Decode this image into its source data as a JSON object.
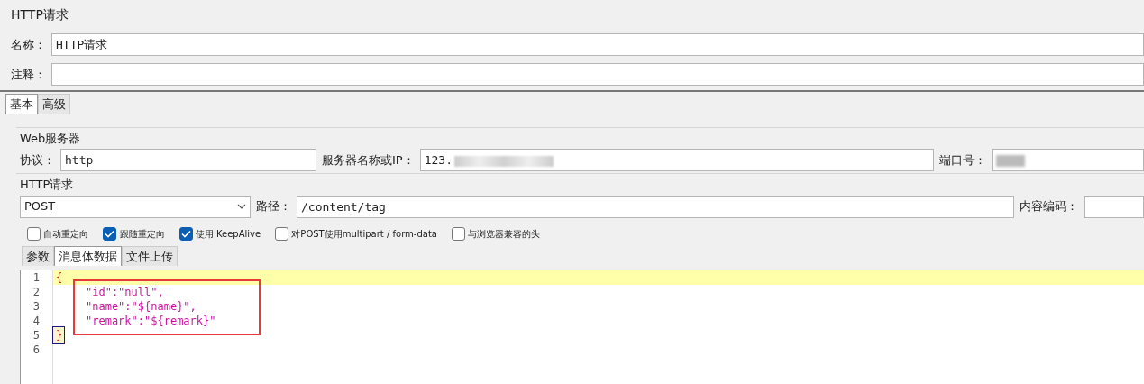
{
  "panel_title": "HTTP请求",
  "name_field": {
    "label": "名称：",
    "value": "HTTP请求"
  },
  "comment_field": {
    "label": "注释："
  },
  "tabs": [
    {
      "label": "基本",
      "selected": true
    },
    {
      "label": "高级",
      "selected": false
    }
  ],
  "web_server": {
    "title": "Web服务器",
    "protocol_label": "协议：",
    "protocol": "http",
    "server_label": "服务器名称或IP：",
    "server": "123.",
    "port_label": "端口号："
  },
  "http_request": {
    "title": "HTTP请求",
    "method": "POST",
    "path_label": "路径：",
    "path": "/content/tag",
    "encoding_label": "内容编码："
  },
  "options": [
    {
      "label": "自动重定向",
      "checked": false
    },
    {
      "label": "跟随重定向",
      "checked": true
    },
    {
      "label": "使用 KeepAlive",
      "checked": true
    },
    {
      "label": "对POST使用multipart / form-data",
      "checked": false
    },
    {
      "label": "与浏览器兼容的头",
      "checked": false
    }
  ],
  "body_tabs": [
    {
      "label": "参数",
      "selected": false
    },
    {
      "label": "消息体数据",
      "selected": true
    },
    {
      "label": "文件上传",
      "selected": false
    }
  ],
  "editor_lines": [
    {
      "number": "1",
      "text": "{",
      "kind": "brace",
      "current": true
    },
    {
      "number": "2",
      "text": "\"id\":\"null\",",
      "kind": "string",
      "current": false
    },
    {
      "number": "3",
      "text": "\"name\":\"${name}\",",
      "kind": "string",
      "current": false
    },
    {
      "number": "4",
      "text": "\"remark\":\"${remark}\"",
      "kind": "string",
      "current": false
    },
    {
      "number": "5",
      "text": "}",
      "kind": "brace",
      "current": false
    },
    {
      "number": "6",
      "current": false
    }
  ]
}
